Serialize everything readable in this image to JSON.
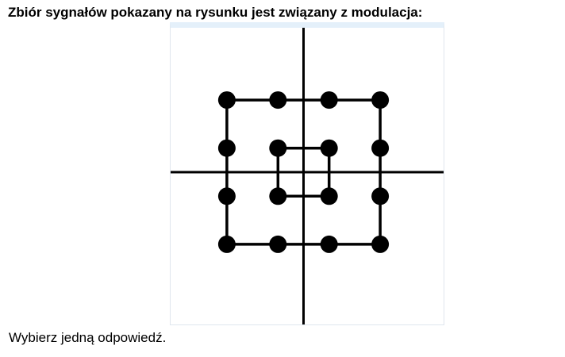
{
  "question": {
    "title": "Zbiór sygnałów pokazany na rysunku jest związany z modulacja:",
    "instruction": "Wybierz jedną odpowiedź."
  },
  "figure": {
    "line_color": "#000000",
    "background": "#ffffff",
    "points": [
      {
        "i": -3,
        "q": 3
      },
      {
        "i": -1,
        "q": 3
      },
      {
        "i": 1,
        "q": 3
      },
      {
        "i": 3,
        "q": 3
      },
      {
        "i": -3,
        "q": 1
      },
      {
        "i": -1,
        "q": 1
      },
      {
        "i": 1,
        "q": 1
      },
      {
        "i": 3,
        "q": 1
      },
      {
        "i": -3,
        "q": -1
      },
      {
        "i": -1,
        "q": -1
      },
      {
        "i": 1,
        "q": -1
      },
      {
        "i": 3,
        "q": -1
      },
      {
        "i": -3,
        "q": -3
      },
      {
        "i": -1,
        "q": -3
      },
      {
        "i": 1,
        "q": -3
      },
      {
        "i": 3,
        "q": -3
      }
    ],
    "rings": [
      [
        {
          "i": -1,
          "q": 1
        },
        {
          "i": 1,
          "q": 1
        },
        {
          "i": 1,
          "q": -1
        },
        {
          "i": -1,
          "q": -1
        }
      ],
      [
        {
          "i": -3,
          "q": 3
        },
        {
          "i": 3,
          "q": 3
        },
        {
          "i": 3,
          "q": -3
        },
        {
          "i": -3,
          "q": -3
        }
      ]
    ]
  }
}
